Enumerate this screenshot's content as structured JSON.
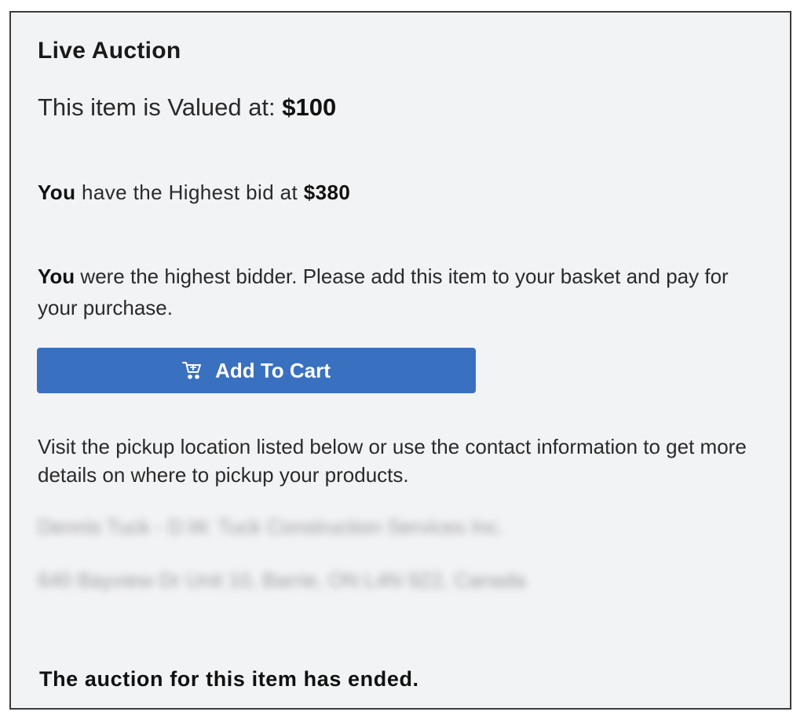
{
  "panel": {
    "title": "Live Auction",
    "valued_prefix": "This item is Valued at: ",
    "valued_amount": "$100",
    "highest_you": "You",
    "highest_text": " have the Highest bid at ",
    "highest_amount": "$380",
    "winner_you": "You",
    "winner_text": " were the highest bidder. Please add this item to your basket and pay for your purchase.",
    "add_to_cart_label": "Add To Cart",
    "add_to_cart_icon": "cart-icon",
    "visit_text": "Visit the pickup location listed below or use the contact information to get more details on where to pickup your products.",
    "contact_name": "Dennis Tuck - D.W. Tuck Construction Services Inc.",
    "contact_address": "640 Bayview Dr Unit 10, Barrie, ON L4N 9Z2, Canada",
    "ended_text": "The auction for this item has ended."
  },
  "colors": {
    "panel_bg": "#f2f3f5",
    "button_bg": "#3a70c0",
    "button_text": "#ffffff",
    "border": "#3c3c3c"
  }
}
